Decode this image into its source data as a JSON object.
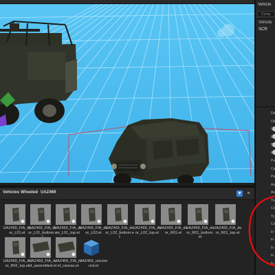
{
  "right_panel": {
    "header": "Vehicle",
    "search_placeholder": "Comp",
    "tree_item_1": "Vehicle",
    "tree_item_2": "SCR",
    "labels": [
      "De",
      "Ob",
      "Ce",
      "Ba",
      "Be",
      "Re",
      "Pa",
      "Ce",
      "Pa",
      "Au",
      "Au",
      "Tra",
      "Co",
      "Ty",
      "Co",
      "Fr",
      "Fr",
      "Fr",
      "Fr",
      "Fr"
    ]
  },
  "breadcrumbs": [
    "Vehicles",
    "Wheeled",
    "UAZ469"
  ],
  "assets": [
    {
      "label": "UAZ469_FIA_door_L01.et",
      "icon": "door-part-thumbnail"
    },
    {
      "label": "UAZ469_FIA_door_L01_bottom.et",
      "icon": "door-part-thumbnail"
    },
    {
      "label": "UAZ469_FIA_door_L01_top.et",
      "icon": "door-part-thumbnail"
    },
    {
      "label": "UAZ469_FIA_door_L02.et",
      "icon": "door-part-thumbnail"
    },
    {
      "label": "UAZ469_FIA_door_L02_bottom.et",
      "icon": "door-part-thumbnail"
    },
    {
      "label": "UAZ469_FIA_door_L02_top.et",
      "icon": "door-part-thumbnail"
    },
    {
      "label": "UAZ469_FIA_door_R01.et",
      "icon": "door-part-thumbnail"
    },
    {
      "label": "UAZ469_FIA_door_R01_bottom.et",
      "icon": "door-part-thumbnail"
    },
    {
      "label": "UAZ469_FIA_door_R01_top.et",
      "icon": "door-part-thumbnail"
    },
    {
      "label": "UAZ469_FIA_door_R02_top.et",
      "icon": "door-part-thumbnail"
    },
    {
      "label": "UAZ469_FIA_roof_assembled.et",
      "icon": "roof-part-thumbnail"
    },
    {
      "label": "UAZ469_FIA_roof_canvas.et",
      "icon": "roof-part-thumbnail"
    },
    {
      "label": "UAZ469_uncovered.et",
      "icon": "cube-icon"
    }
  ],
  "colors": {
    "viewport_sky": "#4fc0f2",
    "selection_box": "#e0304a",
    "annotation": "#e01010",
    "accent": "#2f7fd6"
  }
}
